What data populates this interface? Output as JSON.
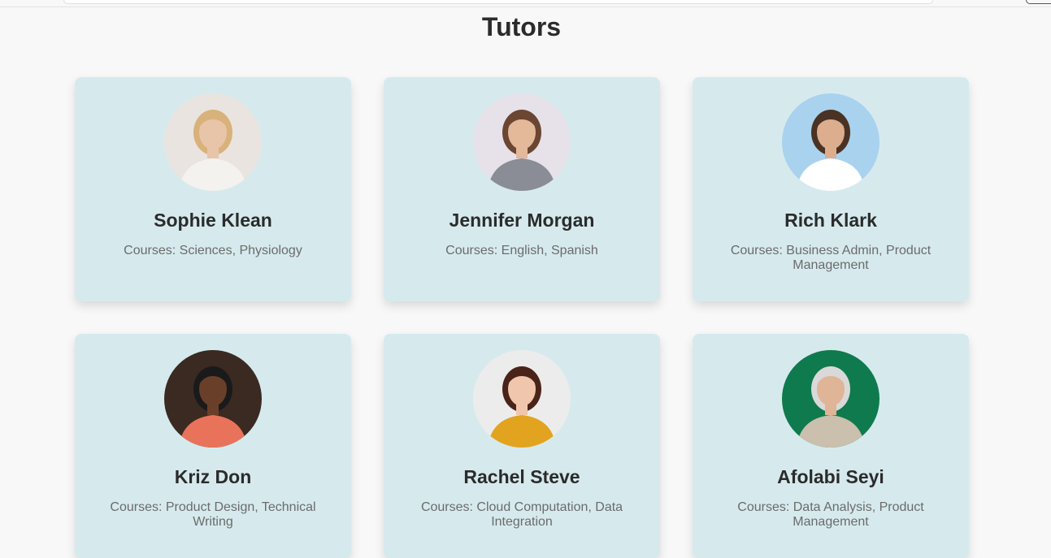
{
  "page": {
    "title": "Tutors"
  },
  "tutors": [
    {
      "name": "Sophie Klean",
      "courses": "Courses: Sciences, Physiology",
      "avatar_icon": "woman-blonde-photo",
      "bg": "#e9e4df",
      "skin": "#e8c5a8",
      "hair": "#d8b27a",
      "shirt": "#f4f2ee"
    },
    {
      "name": "Jennifer Morgan",
      "courses": "Courses: English, Spanish",
      "avatar_icon": "woman-glasses-photo",
      "bg": "#e7e2ea",
      "skin": "#e3b99a",
      "hair": "#6b4632",
      "shirt": "#8a8d96"
    },
    {
      "name": "Rich Klark",
      "courses": "Courses: Business Admin, Product Management",
      "avatar_icon": "man-white-shirt-photo",
      "bg": "#a9d2ee",
      "skin": "#dcae8e",
      "hair": "#4a3324",
      "shirt": "#ffffff"
    },
    {
      "name": "Kriz Don",
      "courses": "Courses: Product Design, Technical Writing",
      "avatar_icon": "man-orange-sweater-photo",
      "bg": "#3a2a22",
      "skin": "#6a3f2a",
      "hair": "#1a1a1a",
      "shirt": "#e9735a"
    },
    {
      "name": "Rachel Steve",
      "courses": "Courses: Cloud Computation, Data Integration",
      "avatar_icon": "woman-yellow-top-photo",
      "bg": "#ececec",
      "skin": "#f0c6ad",
      "hair": "#4a2418",
      "shirt": "#e2a31e"
    },
    {
      "name": "Afolabi Seyi",
      "courses": "Courses: Data Analysis, Product Management",
      "avatar_icon": "teacher-chalkboard-photo",
      "bg": "#0f7a4d",
      "skin": "#e0b496",
      "hair": "#d9d9d9",
      "shirt": "#cbbfae"
    }
  ]
}
